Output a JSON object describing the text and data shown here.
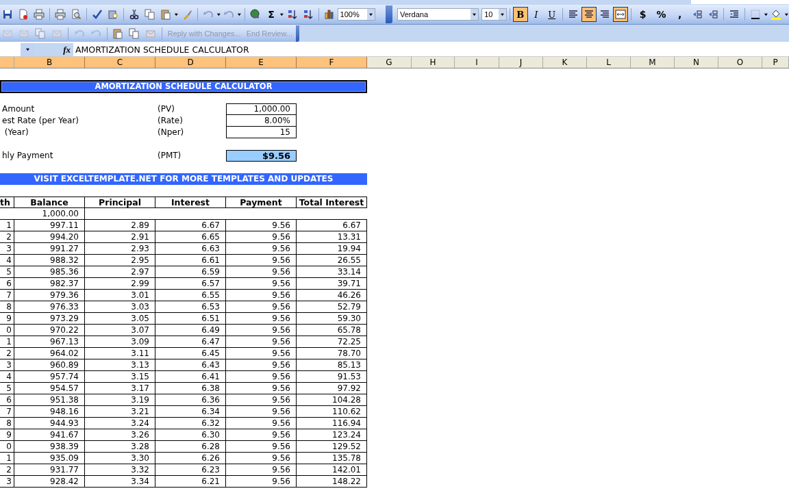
{
  "standard_toolbar": {
    "sum_symbol": "Σ",
    "zoom": "100%"
  },
  "formatting_toolbar": {
    "font": "Verdana",
    "size": "10",
    "styles": [
      {
        "label": "B",
        "kind": "bold",
        "selected": true
      },
      {
        "label": "I",
        "kind": "italic",
        "selected": false
      },
      {
        "label": "U",
        "kind": "underline",
        "selected": false
      }
    ],
    "alignment": [
      {
        "kind": "left",
        "selected": false
      },
      {
        "kind": "center",
        "selected": true
      },
      {
        "kind": "right",
        "selected": false
      },
      {
        "kind": "merge",
        "selected": true
      }
    ],
    "number_formats": [
      "$",
      "%",
      ","
    ]
  },
  "reviewing_toolbar": {
    "actions": [
      {
        "label": "Reply with Changes...",
        "disabled": true
      },
      {
        "label": "End Review...",
        "disabled": true
      }
    ]
  },
  "formula_bar": {
    "fx": "fx",
    "value": "AMORTIZATION SCHEDULE CALCULATOR"
  },
  "columns": [
    {
      "label": "B",
      "selected": true
    },
    {
      "label": "C",
      "selected": true
    },
    {
      "label": "D",
      "selected": true
    },
    {
      "label": "E",
      "selected": true
    },
    {
      "label": "F",
      "selected": true
    },
    {
      "label": "G",
      "selected": false
    },
    {
      "label": "H",
      "selected": false
    },
    {
      "label": "I",
      "selected": false
    },
    {
      "label": "J",
      "selected": false
    },
    {
      "label": "K",
      "selected": false
    },
    {
      "label": "L",
      "selected": false
    },
    {
      "label": "M",
      "selected": false
    },
    {
      "label": "N",
      "selected": false
    },
    {
      "label": "O",
      "selected": false
    },
    {
      "label": "P",
      "selected": false
    }
  ],
  "sheet": {
    "title": "AMORTIZATION SCHEDULE CALCULATOR",
    "title_selected": true,
    "inputs": [
      {
        "label": "Amount",
        "code": "(PV)",
        "value": "1,000.00"
      },
      {
        "label": "est Rate (per Year)",
        "code": "(Rate)",
        "value": "8.00%"
      },
      {
        "label": " (Year)",
        "code": "(Nper)",
        "value": "15"
      }
    ],
    "payment": {
      "label": "hly Payment",
      "code": "(PMT)",
      "value": "$9.56"
    },
    "banner": "VISIT EXCELTEMPLATE.NET FOR MORE TEMPLATES AND UPDATES",
    "table": {
      "columns": [
        "th",
        "Balance",
        "Principal",
        "Interest",
        "Payment",
        "Total Interest"
      ],
      "start": {
        "balance": "1,000.00"
      },
      "rows": [
        [
          "1",
          "997.11",
          "2.89",
          "6.67",
          "9.56",
          "6.67"
        ],
        [
          "2",
          "994.20",
          "2.91",
          "6.65",
          "9.56",
          "13.31"
        ],
        [
          "3",
          "991.27",
          "2.93",
          "6.63",
          "9.56",
          "19.94"
        ],
        [
          "4",
          "988.32",
          "2.95",
          "6.61",
          "9.56",
          "26.55"
        ],
        [
          "5",
          "985.36",
          "2.97",
          "6.59",
          "9.56",
          "33.14"
        ],
        [
          "6",
          "982.37",
          "2.99",
          "6.57",
          "9.56",
          "39.71"
        ],
        [
          "7",
          "979.36",
          "3.01",
          "6.55",
          "9.56",
          "46.26"
        ],
        [
          "8",
          "976.33",
          "3.03",
          "6.53",
          "9.56",
          "52.79"
        ],
        [
          "9",
          "973.29",
          "3.05",
          "6.51",
          "9.56",
          "59.30"
        ],
        [
          "0",
          "970.22",
          "3.07",
          "6.49",
          "9.56",
          "65.78"
        ],
        [
          "1",
          "967.13",
          "3.09",
          "6.47",
          "9.56",
          "72.25"
        ],
        [
          "2",
          "964.02",
          "3.11",
          "6.45",
          "9.56",
          "78.70"
        ],
        [
          "3",
          "960.89",
          "3.13",
          "6.43",
          "9.56",
          "85.13"
        ],
        [
          "4",
          "957.74",
          "3.15",
          "6.41",
          "9.56",
          "91.53"
        ],
        [
          "5",
          "954.57",
          "3.17",
          "6.38",
          "9.56",
          "97.92"
        ],
        [
          "6",
          "951.38",
          "3.19",
          "6.36",
          "9.56",
          "104.28"
        ],
        [
          "7",
          "948.16",
          "3.21",
          "6.34",
          "9.56",
          "110.62"
        ],
        [
          "8",
          "944.93",
          "3.24",
          "6.32",
          "9.56",
          "116.94"
        ],
        [
          "9",
          "941.67",
          "3.26",
          "6.30",
          "9.56",
          "123.24"
        ],
        [
          "0",
          "938.39",
          "3.28",
          "6.28",
          "9.56",
          "129.52"
        ],
        [
          "1",
          "935.09",
          "3.30",
          "6.26",
          "9.56",
          "135.78"
        ],
        [
          "2",
          "931.77",
          "3.32",
          "6.23",
          "9.56",
          "142.01"
        ],
        [
          "3",
          "928.42",
          "3.34",
          "6.21",
          "9.56",
          "148.22"
        ]
      ]
    }
  }
}
